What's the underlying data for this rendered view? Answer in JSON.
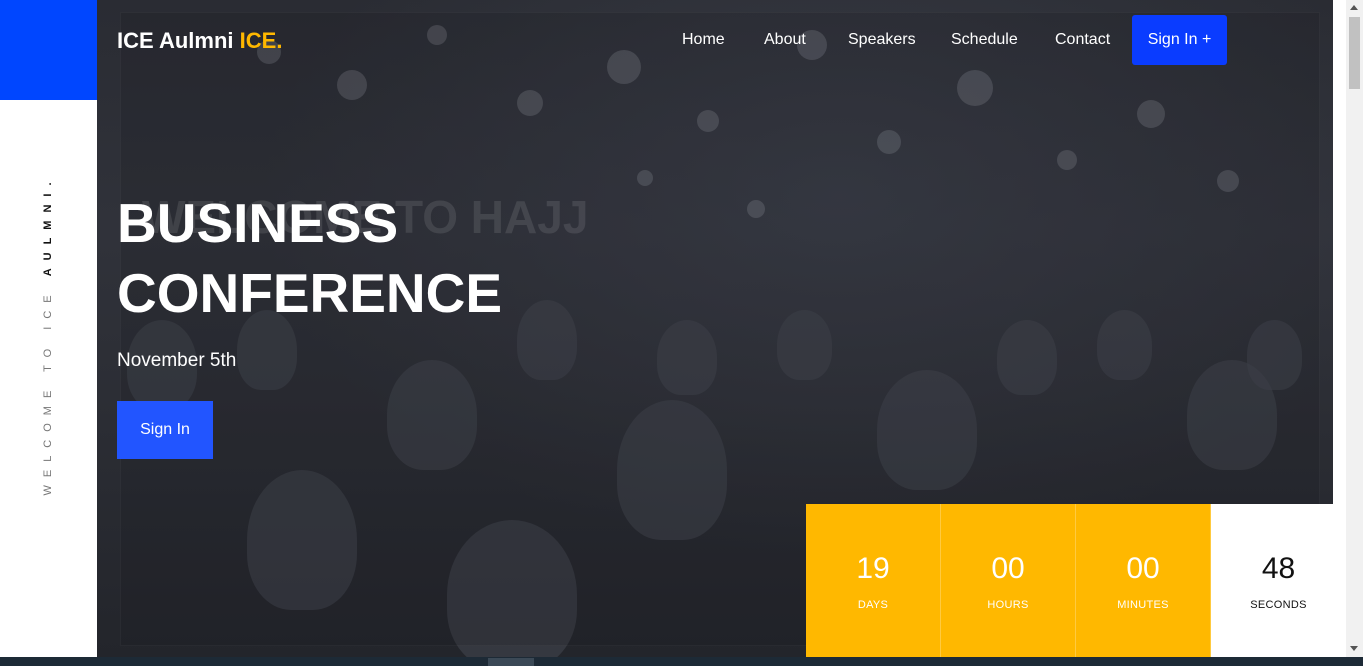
{
  "side_text": {
    "light": "WELCOME  TO  ICE  ",
    "bold": "AULMNI."
  },
  "brand": {
    "name": "ICE Aulmni ",
    "accent": "ICE."
  },
  "nav": {
    "items": [
      "Home",
      "About",
      "Speakers",
      "Schedule",
      "Contact"
    ],
    "signin_label": "Sign In +"
  },
  "hero": {
    "ghost_text": "WELCOME TO HAJJ",
    "title_line1": "BUSINESS",
    "title_line2": "CONFERENCE",
    "date": "November 5th",
    "signin_label": "Sign In"
  },
  "countdown": [
    {
      "value": "19",
      "label": "DAYS"
    },
    {
      "value": "00",
      "label": "HOURS"
    },
    {
      "value": "00",
      "label": "MINUTES"
    },
    {
      "value": "48",
      "label": "SECONDS"
    }
  ],
  "colors": {
    "accent_blue": "#0a3cff",
    "accent_yellow": "#ffb800"
  }
}
